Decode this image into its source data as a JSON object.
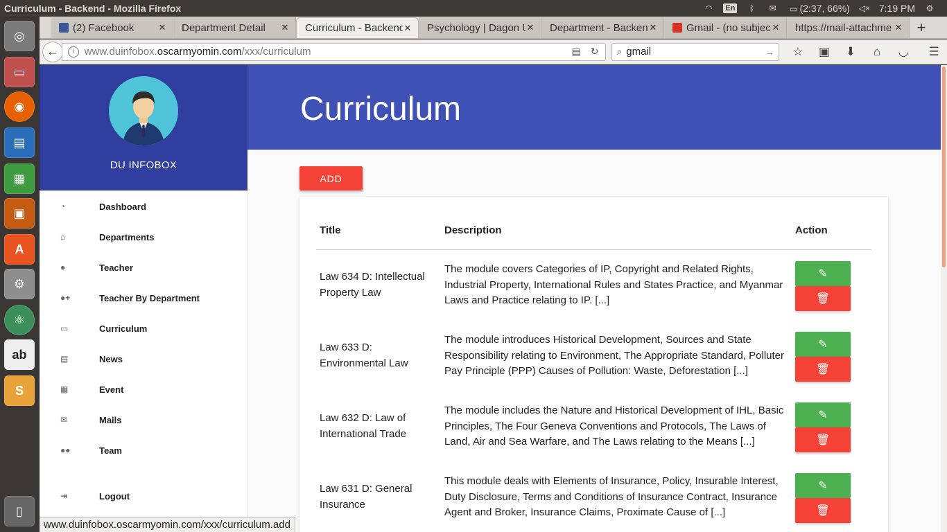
{
  "system": {
    "window_title": "Curriculum - Backend - Mozilla Firefox",
    "keyboard_layout": "En",
    "battery": "(2:37, 66%)",
    "clock": "7:19 PM"
  },
  "launcher": {
    "items": [
      "ubuntu-dash",
      "files",
      "firefox",
      "libreoffice-writer",
      "libreoffice-calc",
      "libreoffice-impress",
      "software-center",
      "system-settings",
      "atom",
      "font-manager",
      "sublime-text",
      "trash"
    ]
  },
  "browser": {
    "tabs": [
      {
        "label": "(2) Facebook",
        "favicon_color": "#3b5998"
      },
      {
        "label": "Department Detail",
        "favicon_color": ""
      },
      {
        "label": "Curriculum - Backend",
        "favicon_color": "",
        "active": true
      },
      {
        "label": "Psychology | Dagon Un",
        "favicon_color": ""
      },
      {
        "label": "Department - Backend",
        "favicon_color": ""
      },
      {
        "label": "Gmail - (no subject)",
        "favicon_color": "#d93025"
      },
      {
        "label": "https://mail-attachme",
        "favicon_color": ""
      }
    ],
    "url_prefix": "www.duinfobox.",
    "url_domain": "oscarmyomin.com",
    "url_path": "/xxx/curriculum",
    "search_value": "gmail",
    "status_url": "www.duinfobox.oscarmyomin.com/xxx/curriculum.add"
  },
  "sidebar": {
    "brand": "DU INFOBOX",
    "items": [
      {
        "label": "Dashboard",
        "icon": "dashboard-icon",
        "glyph": "◔"
      },
      {
        "label": "Departments",
        "icon": "bank-icon",
        "glyph": "⌂"
      },
      {
        "label": "Teacher",
        "icon": "user-icon",
        "glyph": "●"
      },
      {
        "label": "Teacher By Department",
        "icon": "user-plus-icon",
        "glyph": "●+"
      },
      {
        "label": "Curriculum",
        "icon": "book-icon",
        "glyph": "▭"
      },
      {
        "label": "News",
        "icon": "newspaper-icon",
        "glyph": "▤"
      },
      {
        "label": "Event",
        "icon": "calendar-icon",
        "glyph": "▦"
      },
      {
        "label": "Mails",
        "icon": "envelope-icon",
        "glyph": "✉"
      },
      {
        "label": "Team",
        "icon": "users-icon",
        "glyph": "●●"
      },
      {
        "label": "Logout",
        "icon": "sign-out-icon",
        "glyph": "⇥"
      }
    ]
  },
  "main": {
    "title": "Curriculum",
    "add_label": "ADD",
    "columns": [
      "Title",
      "Description",
      "Action"
    ],
    "rows": [
      {
        "title": "Law 634 D: Intellectual Property Law",
        "description": "The module covers Categories of IP, Copyright and Related Rights, Industrial Property, International Rules and States Practice, and Myanmar Laws and Practice relating to IP. [...]"
      },
      {
        "title": "Law 633 D: Environmental Law",
        "description": "The module introduces Historical Development, Sources and State Responsibility relating to Environment, The Appropriate Standard, Polluter Pay Principle (PPP) Causes of Pollution: Waste, Deforestation [...]"
      },
      {
        "title": "Law 632 D: Law of International Trade",
        "description": "The module includes the Nature and Historical Development of IHL, Basic Principles, The Four Geneva Conventions and Protocols, The Laws of Land, Air and Sea Warfare, and The Laws relating to the Means [...]"
      },
      {
        "title": "Law 631 D: General Insurance",
        "description": "This module deals with Elements of Insurance, Policy, Insurable Interest, Duty Disclosure, Terms and Conditions of Insurance Contract, Insurance Agent and Broker, Insurance Claims, Proximate Cause of [...]"
      }
    ]
  },
  "colors": {
    "sidebar_header": "#303f9f",
    "banner": "#3f51b5",
    "add_button": "#f44336",
    "edit_button": "#4caf50",
    "delete_button": "#f44336"
  }
}
